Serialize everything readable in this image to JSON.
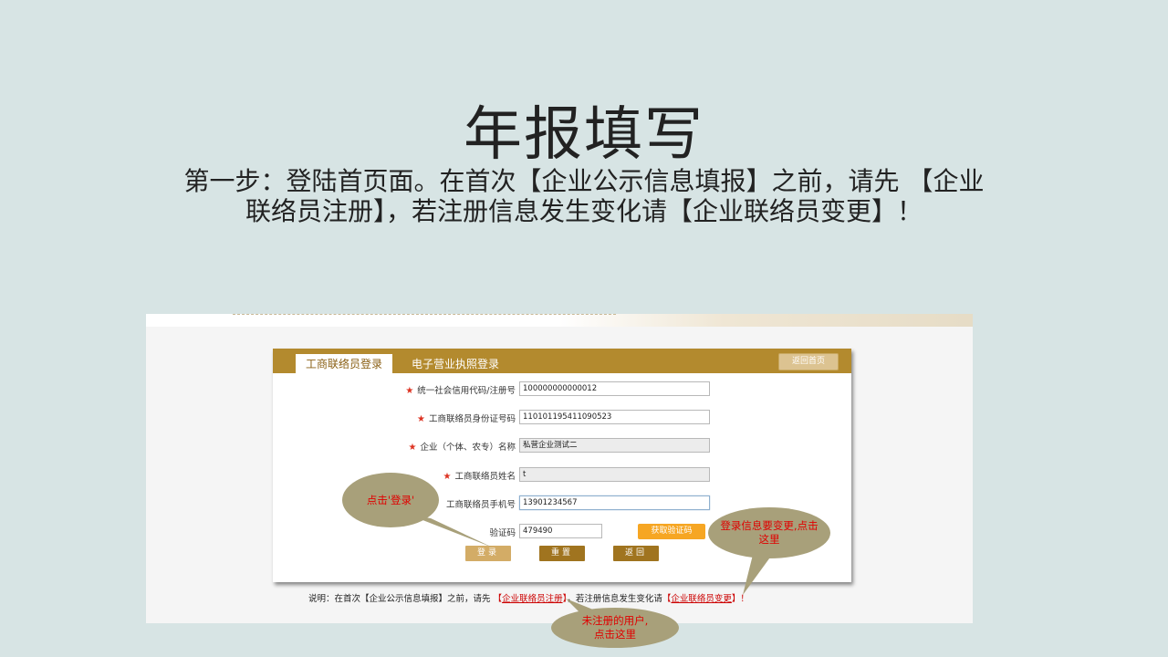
{
  "slide": {
    "title": "年报填写",
    "subtitle_line1": "第一步：登陆首页面。在首次【企业公示信息填报】之前，请先 【企业",
    "subtitle_line2": "联络员注册】，若注册信息发生变化请【企业联络员变更】！"
  },
  "tabs": {
    "active": "工商联络员登录",
    "other": "电子营业执照登录",
    "home": "返回首页"
  },
  "form": {
    "fields": [
      {
        "label": "统一社会信用代码/注册号",
        "value": "100000000000012",
        "required": true
      },
      {
        "label": "工商联络员身份证号码",
        "value": "110101195411090523",
        "required": true
      },
      {
        "label": "企业（个体、农专）名称",
        "value": "私营企业测试二",
        "required": true
      },
      {
        "label": "工商联络员姓名",
        "value": "t",
        "required": true
      },
      {
        "label": "工商联络员手机号",
        "value": "13901234567",
        "required": false
      }
    ],
    "captcha_label": "验证码",
    "captcha_value": "479490",
    "get_code": "获取验证码",
    "star": "★"
  },
  "buttons": {
    "login": "登录",
    "reset": "重置",
    "back": "返回"
  },
  "note": {
    "prefix": "说明：在首次【企业公示信息填报】之前，请先",
    "register": "企业联络员注册",
    "middle": "，若注册信息发生变化请",
    "change": "企业联络员变更",
    "suffix": "！"
  },
  "callouts": {
    "login": "点击'登录'",
    "change": "登录信息要变更,点击这里",
    "register_line1": "未注册的用户,",
    "register_line2": "点击这里"
  },
  "colors": {
    "header_bar": "#b38a2e",
    "callout_bg": "#a8a07a",
    "callout_text": "#e00000",
    "code_button": "#f6a623"
  }
}
